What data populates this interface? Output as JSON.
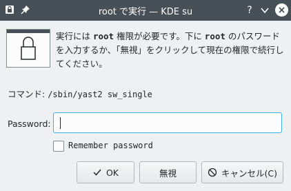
{
  "window": {
    "title": "root で実行 — KDE su",
    "icons": {
      "app": "lock-icon",
      "pin": "pin-icon",
      "help": "help-icon",
      "minimize": "chevron-down-icon",
      "close": "close-icon"
    }
  },
  "message": {
    "part1": "実行には ",
    "root1": "root",
    "part2": " 権限が必要です。下に ",
    "root2": "root",
    "part3": " のパスワードを入力するか、「無視」をクリックして現在の権限で続行してください。"
  },
  "command": {
    "label": "コマンド: ",
    "value": "/sbin/yast2 sw_single"
  },
  "password": {
    "label": "Password:",
    "value": ""
  },
  "remember": {
    "label": "Remember password",
    "checked": false
  },
  "buttons": {
    "ok": "OK",
    "ignore": "無視",
    "cancel": "キャンセル(C)"
  },
  "colors": {
    "titlebar": "#475057",
    "focus": "#3daee9",
    "background": "#eff0f1"
  }
}
